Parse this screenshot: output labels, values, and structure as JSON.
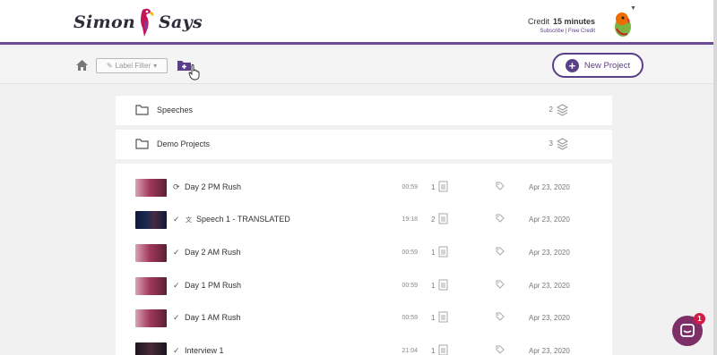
{
  "brand": {
    "word1": "Simon",
    "word2": "Says"
  },
  "credit": {
    "label": "Credit",
    "amount": "15 minutes",
    "links": "Subscribe | Free Credit"
  },
  "toolbar": {
    "label_filter": "Label Filter",
    "new_project": "New Project"
  },
  "folders": [
    {
      "name": "Speeches",
      "count": "2"
    },
    {
      "name": "Demo Projects",
      "count": "3"
    }
  ],
  "media": [
    {
      "title": "Day 2 PM Rush",
      "status": "syncing",
      "duration": "00:59",
      "count": "1",
      "date": "Apr 23, 2020",
      "translated": false
    },
    {
      "title": "Speech 1 - TRANSLATED",
      "status": "done",
      "duration": "19:18",
      "count": "2",
      "date": "Apr 23, 2020",
      "translated": true
    },
    {
      "title": "Day 2 AM Rush",
      "status": "done",
      "duration": "00:59",
      "count": "1",
      "date": "Apr 23, 2020",
      "translated": false
    },
    {
      "title": "Day 1 PM Rush",
      "status": "done",
      "duration": "00:59",
      "count": "1",
      "date": "Apr 23, 2020",
      "translated": false
    },
    {
      "title": "Day 1 AM Rush",
      "status": "done",
      "duration": "00:59",
      "count": "1",
      "date": "Apr 23, 2020",
      "translated": false
    },
    {
      "title": "Interview 1",
      "status": "done",
      "duration": "21:04",
      "count": "1",
      "date": "Apr 23, 2020",
      "translated": false
    }
  ],
  "chat": {
    "badge": "1"
  },
  "colors": {
    "accent": "#5a3f88",
    "header_rule": "#6b4a96",
    "chat": "#7d2f67",
    "badge": "#d11a45"
  }
}
